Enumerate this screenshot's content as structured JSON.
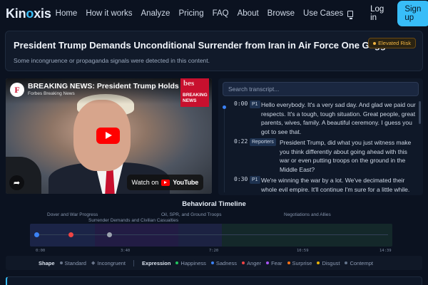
{
  "nav": {
    "logo_pre": "Kin",
    "logo_o": "o",
    "logo_post": "xis",
    "links": [
      "Home",
      "How it works",
      "Analyze",
      "Pricing",
      "FAQ",
      "About",
      "Browse",
      "Use Cases"
    ],
    "login": "Log in",
    "signup": "Sign up",
    "display_icon": "monitor-icon"
  },
  "header": {
    "title": "President Trump Demands Unconditional Surrender from Iran in Air Force One Gaggle",
    "subtitle": "Some incongruence or propaganda signals were detected in this content.",
    "risk_badge": "Elevated Risk",
    "risk_color": "#f0b441"
  },
  "video": {
    "title": "BREAKING NEWS: President Trump Holds Gaggle Ab",
    "channel": "Forbes Breaking News",
    "channel_initial": "F",
    "corner_brand": "bes",
    "corner_label": "BREAKING NEWS",
    "watch_on": "Watch on",
    "youtube": "YouTube",
    "share_icon": "share-icon",
    "play_icon": "play-icon"
  },
  "transcript": {
    "search_placeholder": "Search transcript...",
    "segments": [
      {
        "time": "0:00",
        "speaker": "P1",
        "text": "Hello everybody. It's a very sad day. And glad we paid our respects. It's a tough, tough situation. Great people, great parents, wives, family. A beautiful ceremony. I guess you got to see that."
      },
      {
        "time": "0:22",
        "speaker": "Reporters",
        "text": "President Trump, did what you just witness make you think differently about going ahead with this war or even putting troops on the ground in the Middle East?"
      },
      {
        "time": "0:30",
        "speaker": "P1",
        "text": "We're winning the war by a lot. We've decimated their whole evil empire. It'll continue I'm sure for a little while."
      }
    ]
  },
  "timeline": {
    "title": "Behavioral Timeline",
    "categories": [
      "Dover and War Progress",
      "Surrender Demands and Civilian Casualties",
      "Oil, SPR, and Ground Troops",
      "Negotiations and Allies"
    ],
    "ticks": [
      "0:00",
      "3:40",
      "7:20",
      "10:59",
      "14:39"
    ],
    "points": [
      {
        "time_s": 0,
        "color": "#3b82f6"
      },
      {
        "time_s": 85,
        "color": "#ef4444"
      },
      {
        "time_s": 180,
        "color": "#9ca3af"
      }
    ],
    "band_colors": [
      "#1b2447",
      "#221c44",
      "#1c2242",
      "#14282a"
    ]
  },
  "legend": {
    "shape_label": "Shape",
    "shapes": [
      "Standard",
      "Incongruent"
    ],
    "expression_label": "Expression",
    "expressions": [
      {
        "name": "Happiness",
        "color": "#22c55e"
      },
      {
        "name": "Sadness",
        "color": "#3b82f6"
      },
      {
        "name": "Anger",
        "color": "#ef4444"
      },
      {
        "name": "Fear",
        "color": "#a855f7"
      },
      {
        "name": "Surprise",
        "color": "#f97316"
      },
      {
        "name": "Disgust",
        "color": "#eab308"
      },
      {
        "name": "Contempt",
        "color": "#64748b"
      }
    ]
  }
}
